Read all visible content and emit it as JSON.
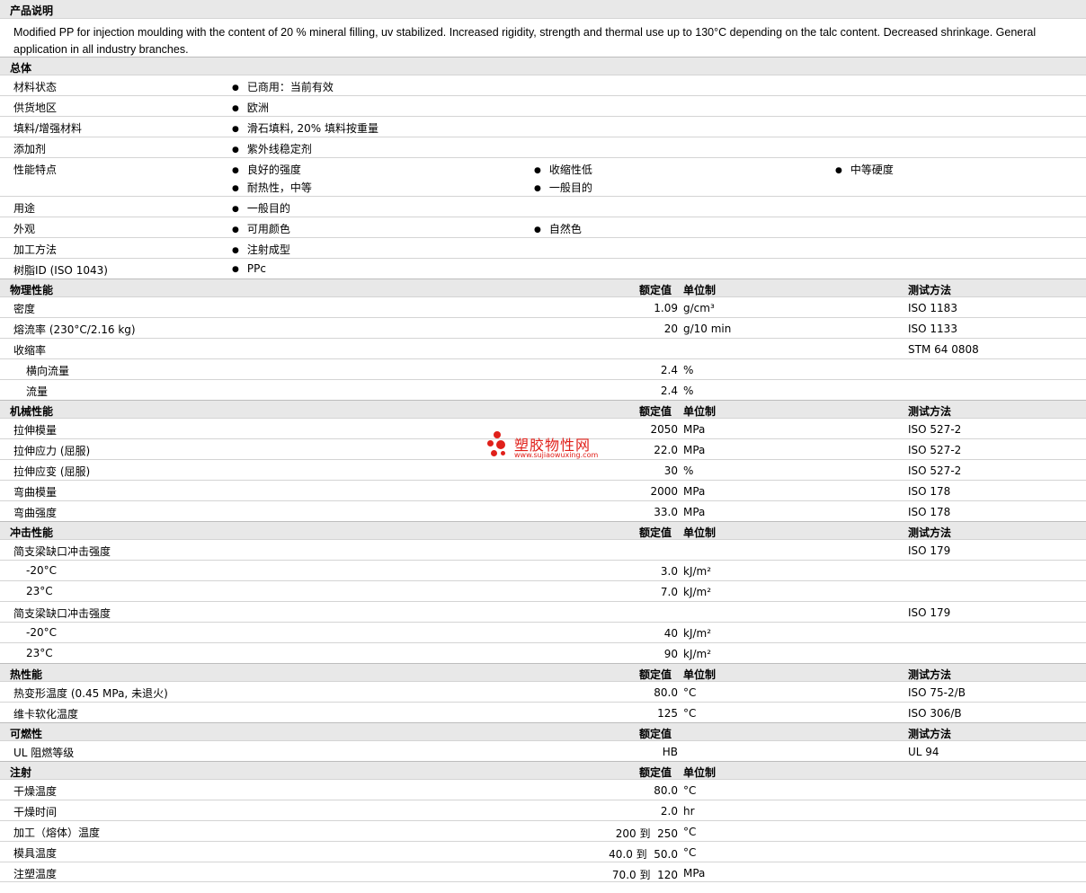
{
  "description": {
    "title": "产品说明",
    "text": "Modified PP for injection moulding with the content of 20 % mineral filling, uv stabilized. Increased rigidity, strength and thermal use up to 130°C depending on the talc content. Decreased shrinkage. General application in all industry branches."
  },
  "general": {
    "title": "总体",
    "rows": [
      {
        "label": "材料状态",
        "items": [
          "已商用：当前有效"
        ]
      },
      {
        "label": "供货地区",
        "items": [
          "欧洲"
        ]
      },
      {
        "label": "填料/增强材料",
        "items": [
          "滑石填料, 20% 填料按重量"
        ]
      },
      {
        "label": "添加剂",
        "items": [
          "紫外线稳定剂"
        ]
      },
      {
        "label": "性能特点",
        "items": [
          "良好的强度",
          "收缩性低",
          "中等硬度",
          "耐热性，中等",
          "一般目的"
        ]
      },
      {
        "label": "用途",
        "items": [
          "一般目的"
        ]
      },
      {
        "label": "外观",
        "items": [
          "可用颜色",
          "自然色"
        ]
      },
      {
        "label": "加工方法",
        "items": [
          "注射成型"
        ]
      },
      {
        "label": "树脂ID (ISO 1043)",
        "items": [
          "PPc"
        ]
      }
    ]
  },
  "column_headers": {
    "nominal": "额定值",
    "unit": "单位制",
    "method": "测试方法"
  },
  "physical": {
    "title": "物理性能",
    "rows": [
      {
        "label": "密度",
        "value": "1.09",
        "unit": "g/cm³",
        "method": "ISO 1183"
      },
      {
        "label": "熔流率 (230°C/2.16 kg)",
        "value": "20",
        "unit": "g/10 min",
        "method": "ISO 1133"
      },
      {
        "label": "收缩率",
        "value": "",
        "unit": "",
        "method": "STM 64 0808"
      },
      {
        "label": "横向流量",
        "value": "2.4",
        "unit": "%",
        "method": ""
      },
      {
        "label": "流量",
        "value": "2.4",
        "unit": "%",
        "method": ""
      }
    ]
  },
  "mechanical": {
    "title": "机械性能",
    "rows": [
      {
        "label": "拉伸模量",
        "value": "2050",
        "unit": "MPa",
        "method": "ISO 527-2"
      },
      {
        "label": "拉伸应力 (屈服)",
        "value": "22.0",
        "unit": "MPa",
        "method": "ISO 527-2"
      },
      {
        "label": "拉伸应变 (屈服)",
        "value": "30",
        "unit": "%",
        "method": "ISO 527-2"
      },
      {
        "label": "弯曲模量",
        "value": "2000",
        "unit": "MPa",
        "method": "ISO 178"
      },
      {
        "label": "弯曲强度",
        "value": "33.0",
        "unit": "MPa",
        "method": "ISO 178"
      }
    ]
  },
  "impact": {
    "title": "冲击性能",
    "rows": [
      {
        "label": "简支梁缺口冲击强度",
        "value": "",
        "unit": "",
        "method": "ISO 179"
      },
      {
        "label": "-20°C",
        "value": "3.0",
        "unit": "kJ/m²",
        "method": ""
      },
      {
        "label": "23°C",
        "value": "7.0",
        "unit": "kJ/m²",
        "method": ""
      },
      {
        "label": "简支梁缺口冲击强度",
        "value": "",
        "unit": "",
        "method": "ISO 179"
      },
      {
        "label": "-20°C",
        "value": "40",
        "unit": "kJ/m²",
        "method": ""
      },
      {
        "label": "23°C",
        "value": "90",
        "unit": "kJ/m²",
        "method": ""
      }
    ]
  },
  "thermal": {
    "title": "热性能",
    "rows": [
      {
        "label": "热变形温度 (0.45 MPa, 未退火)",
        "value": "80.0",
        "unit": "°C",
        "method": "ISO 75-2/B"
      },
      {
        "label": "维卡软化温度",
        "value": "125",
        "unit": "°C",
        "method": "ISO 306/B"
      }
    ]
  },
  "flammability": {
    "title": "可燃性",
    "rows": [
      {
        "label": "UL 阻燃等级",
        "value": "HB",
        "unit": "",
        "method": "UL 94"
      }
    ]
  },
  "injection": {
    "title": "注射",
    "rows": [
      {
        "label": "干燥温度",
        "value": "80.0",
        "unit": "°C",
        "method": ""
      },
      {
        "label": "干燥时间",
        "value": "2.0",
        "unit": "hr",
        "method": ""
      },
      {
        "label": "加工（熔体）温度",
        "value": "200 到  250",
        "unit": "°C",
        "method": ""
      },
      {
        "label": "模具温度",
        "value": "40.0 到  50.0",
        "unit": "°C",
        "method": ""
      },
      {
        "label": "注塑温度",
        "value": "70.0 到  120",
        "unit": "MPa",
        "method": ""
      }
    ]
  },
  "watermark": {
    "name": "塑胶物性网",
    "url": "www.sujiaowuxing.com"
  }
}
